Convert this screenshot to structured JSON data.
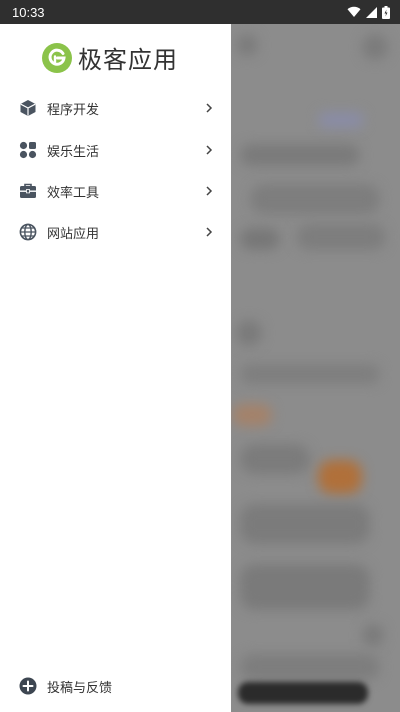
{
  "status_bar": {
    "time": "10:33"
  },
  "app": {
    "logo_text": "极客应用"
  },
  "drawer": {
    "items": [
      {
        "label": "程序开发",
        "icon": "cube-icon"
      },
      {
        "label": "娱乐生活",
        "icon": "dots-grid-icon"
      },
      {
        "label": "效率工具",
        "icon": "toolbox-icon"
      },
      {
        "label": "网站应用",
        "icon": "globe-icon"
      }
    ],
    "footer": {
      "label": "投稿与反馈",
      "icon": "plus-circle-icon"
    }
  },
  "colors": {
    "logo_green": "#8bc34a",
    "status_bar": "#2f2f2f",
    "scrim": "#8c8c8c",
    "icon": "#4a5460"
  }
}
